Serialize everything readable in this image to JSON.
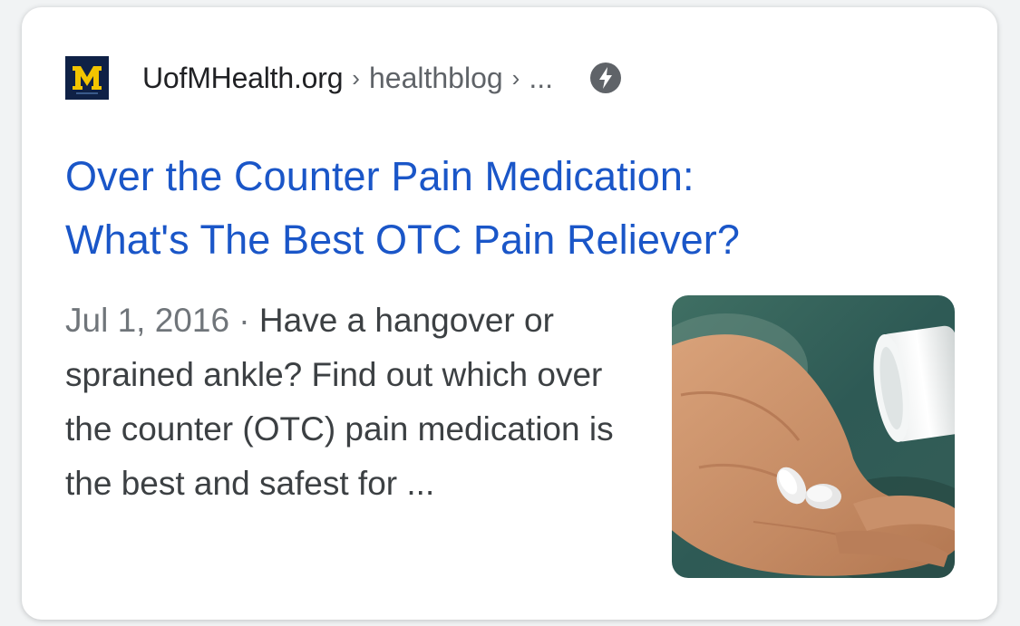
{
  "result": {
    "favicon": {
      "icon": "block-m-logo-icon",
      "letter": "M",
      "bg_color": "#0f2146",
      "letter_color": "#f2c400"
    },
    "site_name": "UofMHealth.org",
    "breadcrumb": [
      "healthblog",
      "..."
    ],
    "breadcrumb_separator": "›",
    "amp_icon": "amp-lightning-icon",
    "title_line1": "Over the Counter Pain Medication:",
    "title_line2": "What's The Best OTC Pain Reliever?",
    "date": "Jul 1, 2016",
    "date_separator": " · ",
    "snippet": "Have a hangover or sprained ankle? Find out which over the counter (OTC) pain medication is the best and safest for ...",
    "thumbnail": {
      "icon": "pills-in-hand-photo"
    },
    "colors": {
      "title": "#1a56c8",
      "site_name": "#202124",
      "breadcrumb": "#5f6368",
      "snippet": "#3c4043",
      "date": "#70757a"
    }
  }
}
